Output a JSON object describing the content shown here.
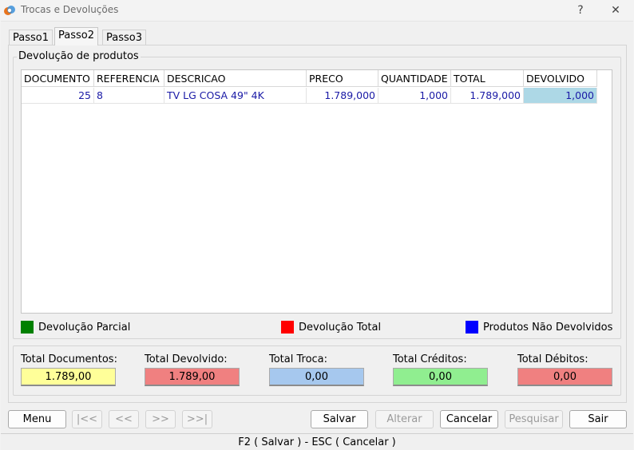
{
  "window": {
    "title": "Trocas e Devoluções",
    "help": "?",
    "close": "✕"
  },
  "tabs": [
    {
      "label": "Passo1"
    },
    {
      "label": "Passo2",
      "active": true
    },
    {
      "label": "Passo3"
    }
  ],
  "group": {
    "title": "Devolução de produtos"
  },
  "grid": {
    "headers": [
      "DOCUMENTO",
      "REFERENCIA",
      "DESCRICAO",
      "PRECO",
      "QUANTIDADE",
      "TOTAL",
      "DEVOLVIDO"
    ],
    "rows": [
      {
        "documento": "25",
        "referencia": "8",
        "descricao": "TV LG COSA 49\" 4K",
        "preco": "1.789,000",
        "quantidade": "1,000",
        "total": "1.789,000",
        "devolvido": "1,000"
      }
    ]
  },
  "legend": [
    {
      "label": "Devolução Parcial",
      "color": "#008000"
    },
    {
      "label": "Devolução Total",
      "color": "#ff0000"
    },
    {
      "label": "Produtos Não Devolvidos",
      "color": "#0000ff"
    }
  ],
  "totals": [
    {
      "label": "Total Documentos:",
      "value": "1.789,00",
      "color": "#ffff99"
    },
    {
      "label": "Total Devolvido:",
      "value": "1.789,00",
      "color": "#f08080"
    },
    {
      "label": "Total Troca:",
      "value": "0,00",
      "color": "#a6c8ee"
    },
    {
      "label": "Total Créditos:",
      "value": "0,00",
      "color": "#90ee90"
    },
    {
      "label": "Total Débitos:",
      "value": "0,00",
      "color": "#f08080"
    }
  ],
  "buttons": {
    "menu": "Menu",
    "first": "|<<",
    "prev": "<<",
    "next": ">>",
    "last": ">>|",
    "salvar": "Salvar",
    "alterar": "Alterar",
    "cancelar": "Cancelar",
    "pesquisar": "Pesquisar",
    "sair": "Sair"
  },
  "status": "F2 ( Salvar )  -  ESC ( Cancelar )"
}
